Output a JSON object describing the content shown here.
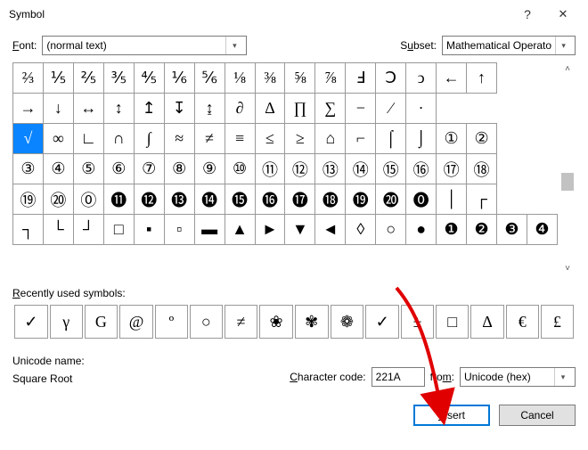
{
  "title": "Symbol",
  "labels": {
    "font_prefix": "F",
    "font_label": "ont:",
    "subset_prefix": "S",
    "subset_label": "ubset:",
    "recent_prefix": "R",
    "recent_label": "ecently used symbols:",
    "uname_label": "Unicode name:",
    "charcode_prefix": "C",
    "charcode_label": "haracter code:",
    "from_prefix": "m",
    "from_before": "fro",
    "from_after": ":"
  },
  "font_value": "(normal text)",
  "subset_value": "Mathematical Operators",
  "char_code": "221A",
  "from_value": "Unicode (hex)",
  "unicode_name": "Square Root",
  "buttons": {
    "insert_prefix": "I",
    "insert_label": "nsert",
    "cancel": "Cancel"
  },
  "grid": [
    [
      "⅔",
      "⅕",
      "⅖",
      "⅗",
      "⅘",
      "⅙",
      "⅚",
      "⅛",
      "⅜",
      "⅝",
      "⅞",
      "Ⅎ",
      "Ↄ",
      "ↄ",
      "←",
      "↑"
    ],
    [
      "→",
      "↓",
      "↔",
      "↕",
      "↥",
      "↧",
      "↨",
      "∂",
      "∆",
      "∏",
      "∑",
      "−",
      "∕",
      "∙"
    ],
    [
      "√",
      "∞",
      "∟",
      "∩",
      "∫",
      "≈",
      "≠",
      "≡",
      "≤",
      "≥",
      "⌂",
      "⌐",
      "⌠",
      "⌡",
      "①",
      "②"
    ],
    [
      "③",
      "④",
      "⑤",
      "⑥",
      "⑦",
      "⑧",
      "⑨",
      "⑩",
      "⑪",
      "⑫",
      "⑬",
      "⑭",
      "⑮",
      "⑯",
      "⑰",
      "⑱"
    ],
    [
      "⑲",
      "⑳",
      "⓪",
      "⓫",
      "⓬",
      "⓭",
      "⓮",
      "⓯",
      "⓰",
      "⓱",
      "⓲",
      "⓳",
      "⓴",
      "⓿",
      "│",
      "┌"
    ],
    [
      "┐",
      "└",
      "┘",
      "□",
      "▪",
      "▫",
      "▬",
      "▲",
      "►",
      "▼",
      "◄",
      "◊",
      "○",
      "●",
      "❶",
      "❷",
      "❸",
      "❹"
    ]
  ],
  "grid_selected": {
    "row": 2,
    "col": 0
  },
  "recent": [
    "✓",
    "γ",
    "G",
    "@",
    "º",
    "○",
    "≠",
    "❀",
    "✾",
    "❁",
    "✓",
    "±",
    "□",
    "Δ",
    "€",
    "£"
  ]
}
